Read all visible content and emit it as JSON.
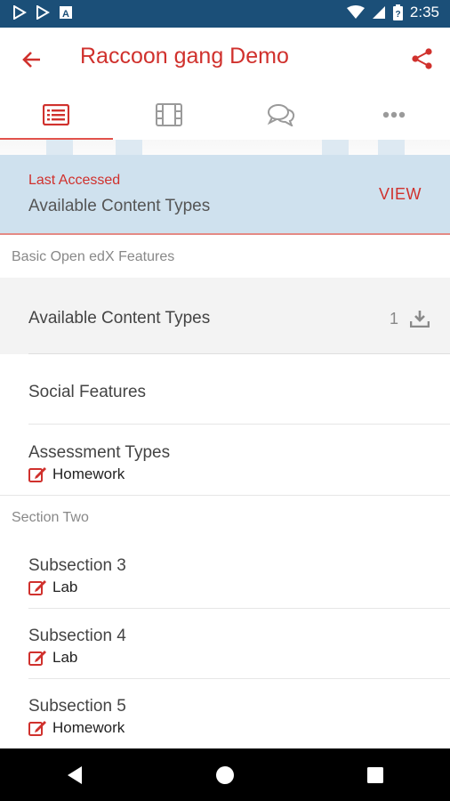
{
  "status_bar": {
    "time": "2:35",
    "notification_icons": [
      "play-store-icon",
      "play-store-icon",
      "a-square-icon"
    ],
    "system_icons": [
      "wifi-icon",
      "signal-icon",
      "battery-icon"
    ]
  },
  "app_bar": {
    "title": "Raccoon gang Demo",
    "back_icon": "arrow-left-icon",
    "share_icon": "share-icon",
    "accent_color": "#d0312d"
  },
  "tabs": [
    {
      "icon": "course-outline-icon",
      "active": true
    },
    {
      "icon": "video-icon",
      "active": false
    },
    {
      "icon": "discussion-icon",
      "active": false
    },
    {
      "icon": "more-icon",
      "active": false
    }
  ],
  "last_accessed": {
    "label": "Last Accessed",
    "title": "Available Content Types",
    "action": "VIEW",
    "background": "#cfe1ee"
  },
  "sections": [
    {
      "header": "Basic Open edX Features",
      "items": [
        {
          "title": "Available Content Types",
          "count": "1",
          "download": true,
          "highlighted": true
        },
        {
          "title": "Social Features"
        },
        {
          "title": "Assessment Types",
          "subtitle": "Homework"
        }
      ]
    },
    {
      "header": "Section Two",
      "items": [
        {
          "title": "Subsection 3",
          "subtitle": "Lab"
        },
        {
          "title": "Subsection 4",
          "subtitle": "Lab"
        },
        {
          "title": "Subsection 5",
          "subtitle": "Homework"
        }
      ]
    }
  ],
  "nav_bar": [
    "back-triangle-icon",
    "home-circle-icon",
    "recents-square-icon"
  ]
}
